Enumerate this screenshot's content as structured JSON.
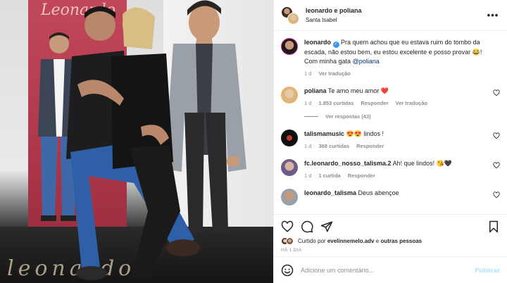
{
  "header": {
    "title": "leonardo e poliana",
    "location": "Santa Isabel",
    "more_label": "•••"
  },
  "caption": {
    "user": "leonardo",
    "text": "Pra quem achou que eu estava ruim do tombo da escada, não estou bem, eu estou excelente e posso provar 😂! Com minha gata",
    "mention": "@poliana",
    "time": "1 d",
    "translate": "Ver tradução"
  },
  "comments": [
    {
      "user": "poliana",
      "text": "Te amo meu amor",
      "emoji": "❤️",
      "time": "1 d",
      "likes": "1.853 curtidas",
      "reply": "Responder",
      "translate": "Ver tradução"
    },
    {
      "user": "talismamusic",
      "text": "😍😍 lindos !",
      "time": "1 d",
      "likes": "368 curtidas",
      "reply": "Responder"
    },
    {
      "user": "fc.leonardo_nosso_talisma.2",
      "text": "Ah! que lindos! 😘🖤",
      "time": "1 d",
      "likes": "1 curtida",
      "reply": "Responder"
    },
    {
      "user": "leonardo_talisma",
      "text": "Deus abençoe"
    }
  ],
  "replies": {
    "label": "Ver respostas (43)"
  },
  "likes": {
    "prefix": "Curtido por",
    "user": "evelinnemelo.adv",
    "connector": "e",
    "others": "outras pessoas"
  },
  "time_ago": "HÁ 1 DIA",
  "composer": {
    "placeholder": "Adicione um comentário...",
    "publish": "Publicar"
  },
  "photo": {
    "banner_script": "Leonardo",
    "floor_script": "leonardo"
  },
  "colors": {
    "accent_blue": "#3897f0",
    "link": "#00376b",
    "heart_red": "#ed4956",
    "muted": "#8e8e8e",
    "banner_red": "#b33a4d"
  },
  "icons": [
    "heart-icon",
    "comment-icon",
    "share-icon",
    "save-icon",
    "emoji-icon",
    "more-icon",
    "verified-icon"
  ]
}
